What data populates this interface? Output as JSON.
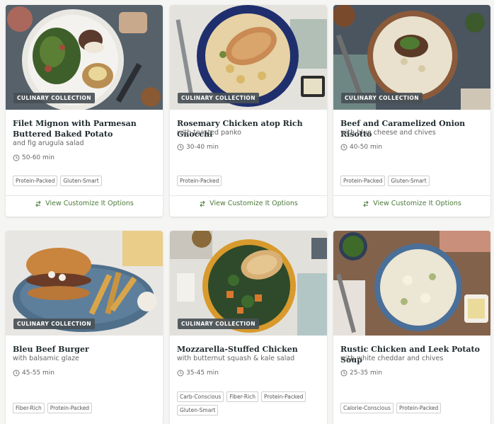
{
  "cards": [
    {
      "badge": "CULINARY COLLECTION",
      "title": "Filet Mignon with Parmesan Buttered Baked Potato",
      "subtitle": "and fig arugula salad",
      "time": "50-60 min",
      "tags": [
        "Protein-Packed",
        "Gluten-Smart"
      ],
      "customize": "View Customize It Options"
    },
    {
      "badge": "CULINARY COLLECTION",
      "title": "Rosemary Chicken atop Rich Gnocchi",
      "subtitle": "with toasted panko",
      "time": "30-40 min",
      "tags": [
        "Protein-Packed"
      ],
      "customize": "View Customize It Options"
    },
    {
      "badge": "CULINARY COLLECTION",
      "title": "Beef and Caramelized Onion Risotto",
      "subtitle": "with blue cheese and chives",
      "time": "40-50 min",
      "tags": [
        "Protein-Packed",
        "Gluten-Smart"
      ],
      "customize": "View Customize It Options"
    },
    {
      "badge": "CULINARY COLLECTION",
      "title": "Bleu Beef Burger",
      "subtitle": "with balsamic glaze",
      "time": "45-55 min",
      "tags": [
        "Fiber-Rich",
        "Protein-Packed"
      ]
    },
    {
      "badge": "CULINARY COLLECTION",
      "title": "Mozzarella-Stuffed Chicken",
      "subtitle": "with butternut squash & kale salad",
      "time": "35-45 min",
      "tags": [
        "Carb-Conscious",
        "Fiber-Rich",
        "Protein-Packed",
        "Gluten-Smart"
      ]
    },
    {
      "badge": "",
      "title": "Rustic Chicken and Leek Potato Soup",
      "subtitle": "with white cheddar and chives",
      "time": "25-35 min",
      "tags": [
        "Calorie-Conscious",
        "Protein-Packed"
      ]
    }
  ],
  "icons": {
    "clock": "clock-icon",
    "swap": "swap-arrows-icon"
  },
  "colors": {
    "accent": "#4b7a3a",
    "badge_bg": "#485056"
  }
}
